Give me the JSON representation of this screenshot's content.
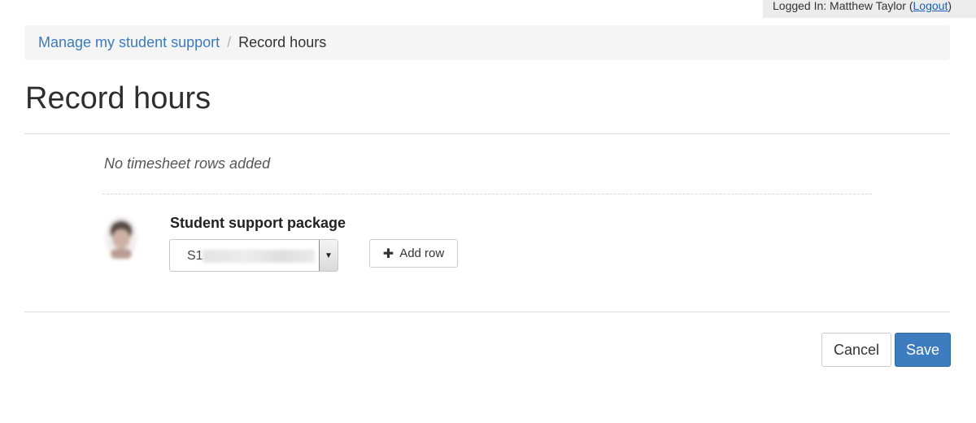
{
  "session": {
    "logged_in_prefix": "Logged In: Matthew Taylor (",
    "logout_label": "Logout",
    "logged_in_suffix": ")"
  },
  "breadcrumb": {
    "parent": "Manage my student support",
    "separator": "/",
    "current": "Record hours"
  },
  "page": {
    "title": "Record hours"
  },
  "timesheet": {
    "empty_message": "No timesheet rows added"
  },
  "package": {
    "label": "Student support package",
    "selected_value": "S1",
    "add_row_label": "Add row"
  },
  "actions": {
    "cancel_label": "Cancel",
    "save_label": "Save"
  },
  "colors": {
    "link": "#3a7bbf",
    "primary": "#3e7cc0",
    "breadcrumb_bg": "#f5f5f5"
  },
  "icons": {
    "add_row": "plus-icon",
    "select": "chevron-down-icon",
    "avatar": "student-avatar"
  }
}
